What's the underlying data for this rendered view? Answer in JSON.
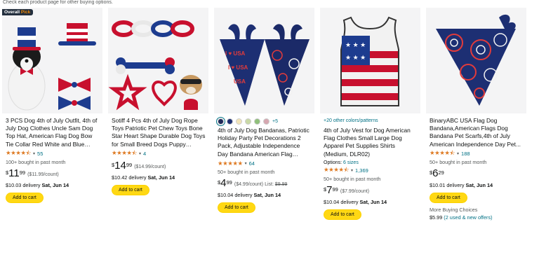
{
  "header_note": "Check each product page for other buying options.",
  "products": [
    {
      "badge_prefix": "Overall",
      "badge_suffix": "Pick",
      "title": "3 PCS Dog 4th of July Outfit, 4th of July Dog Clothes Uncle Sam Dog Top Hat, American Flag Dog Bow Tie Collar Red White and Blue Dog...",
      "stars": "★★★★⯪",
      "rating_count": "55",
      "bought": "100+ bought in past month",
      "price_currency": "$",
      "price_dollars": "11",
      "price_cents": "99",
      "unit_price": "($11.99/count)",
      "delivery_label": "$10.03 delivery",
      "delivery_date": "Sat, Jun 14",
      "add_label": "Add to cart"
    },
    {
      "title": "Sotiff 4 Pcs 4th of July Dog Rope Toys Patriotic Pet Chew Toys Bone Star Heart Shape Durable Dog Toys for Small Breed Dogs Puppy Teethi...",
      "stars": "★★★★⯪",
      "rating_count": "4",
      "price_currency": "$",
      "price_dollars": "14",
      "price_cents": "99",
      "unit_price": "($14.99/count)",
      "delivery_label": "$10.42 delivery",
      "delivery_date": "Sat, Jun 14",
      "add_label": "Add to cart"
    },
    {
      "more_colors": "+5",
      "swatch_colors": [
        "#1f2a5a",
        "#1d2f73",
        "#f2e4b8",
        "#c9d9a6",
        "#8fbf7a",
        "#d6a7b0"
      ],
      "title": "4th of July Dog Bandanas, Patriotic Holiday Party Pet Decorations 2 Pack, Adjustable Independence Day Bandana American Flag Triangle Bi...",
      "stars": "★★★★★",
      "rating_count": "64",
      "bought": "50+ bought in past month",
      "price_currency": "$",
      "price_dollars": "4",
      "price_cents": "99",
      "unit_price": "($4.99/count)",
      "list_label": "List:",
      "list_price": "$9.99",
      "delivery_label": "$10.04 delivery",
      "delivery_date": "Sat, Jun 14",
      "add_label": "Add to cart"
    },
    {
      "colors_link": "+20 other colors/patterns",
      "title": "4th of July Vest for Dog American Flag Clothes Small Large Dog Apparel Pet Supplies Shirts (Medium, DLR02)",
      "options_label": "Options:",
      "options_value": "6 sizes",
      "stars": "★★★★⯪",
      "rating_count": "1,369",
      "bought": "50+ bought in past month",
      "price_currency": "$",
      "price_dollars": "7",
      "price_cents": "99",
      "unit_price": "($7.99/count)",
      "delivery_label": "$10.04 delivery",
      "delivery_date": "Sat, Jun 14",
      "add_label": "Add to cart"
    },
    {
      "title": "BinaryABC USA Flag Dog Bandana,American Flags Dog Bandana Pet Scarfs,4th of July American Independence Day Pet...",
      "stars": "★★★★⯪",
      "rating_count": "188",
      "bought": "50+ bought in past month",
      "price_currency": "$",
      "price_dollars": "6",
      "price_cents": "29",
      "delivery_label": "$10.01 delivery",
      "delivery_date": "Sat, Jun 14",
      "add_label": "Add to cart",
      "buying_choices": "More Buying Choices",
      "used_price": "$5.99",
      "used_link": "(2 used & new offers)"
    }
  ]
}
